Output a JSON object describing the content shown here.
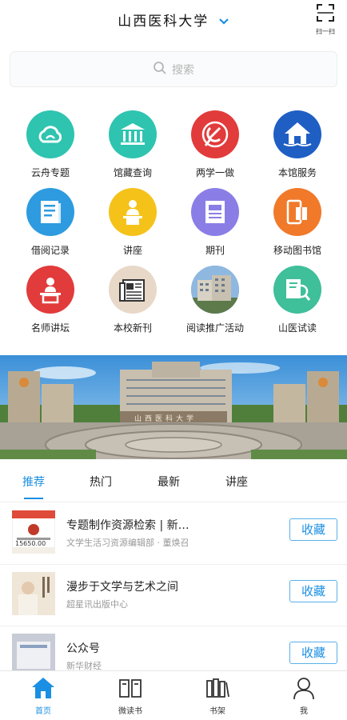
{
  "header": {
    "title": "山西医科大学",
    "scan_label": "扫一扫"
  },
  "search": {
    "placeholder": "搜索"
  },
  "grid": [
    {
      "label": "云舟专题",
      "color": "#2ec4b0",
      "icon": "cloud-icon"
    },
    {
      "label": "馆藏查询",
      "color": "#2ec4b0",
      "icon": "museum-icon"
    },
    {
      "label": "两学一做",
      "color": "#e23b3b",
      "icon": "party-emblem-icon"
    },
    {
      "label": "本馆服务",
      "color": "#1f5fc4",
      "icon": "home-service-icon"
    },
    {
      "label": "借阅记录",
      "color": "#2e9be0",
      "icon": "book-record-icon"
    },
    {
      "label": "讲座",
      "color": "#f5c21a",
      "icon": "lecture-icon"
    },
    {
      "label": "期刊",
      "color": "#8a7ee6",
      "icon": "journal-icon"
    },
    {
      "label": "移动图书馆",
      "color": "#f07a2a",
      "icon": "mobile-library-icon"
    },
    {
      "label": "名师讲坛",
      "color": "#e23b3b",
      "icon": "podium-icon"
    },
    {
      "label": "本校新刊",
      "color": "#e8d8c8",
      "icon": "newspaper-icon"
    },
    {
      "label": "阅读推广活动",
      "color": "#5a8fc4",
      "icon": "building-photo-icon"
    },
    {
      "label": "山医试读",
      "color": "#3fbf9a",
      "icon": "trial-read-icon"
    }
  ],
  "banner": {
    "sign": "山西医科大学"
  },
  "tabs": [
    {
      "label": "推荐",
      "active": true
    },
    {
      "label": "热门",
      "active": false
    },
    {
      "label": "最新",
      "active": false
    },
    {
      "label": "讲座",
      "active": false
    }
  ],
  "list": [
    {
      "title": "专题制作资源检索 | 新…",
      "subtitle": "文学生活习资源编辑部 · 董焕召",
      "button": "收藏",
      "thumb_price": "15650.00"
    },
    {
      "title": "漫步于文学与艺术之间",
      "subtitle": "超星讯出版中心",
      "button": "收藏"
    },
    {
      "title": "公众号",
      "subtitle": "新华财经",
      "button": "收藏"
    }
  ],
  "bottom_nav": [
    {
      "label": "首页",
      "icon": "home-icon",
      "active": true
    },
    {
      "label": "微读书",
      "icon": "open-book-icon",
      "active": false
    },
    {
      "label": "书架",
      "icon": "bookshelf-icon",
      "active": false
    },
    {
      "label": "我",
      "icon": "user-icon",
      "active": false
    }
  ],
  "colors": {
    "accent": "#1a8fe3"
  }
}
